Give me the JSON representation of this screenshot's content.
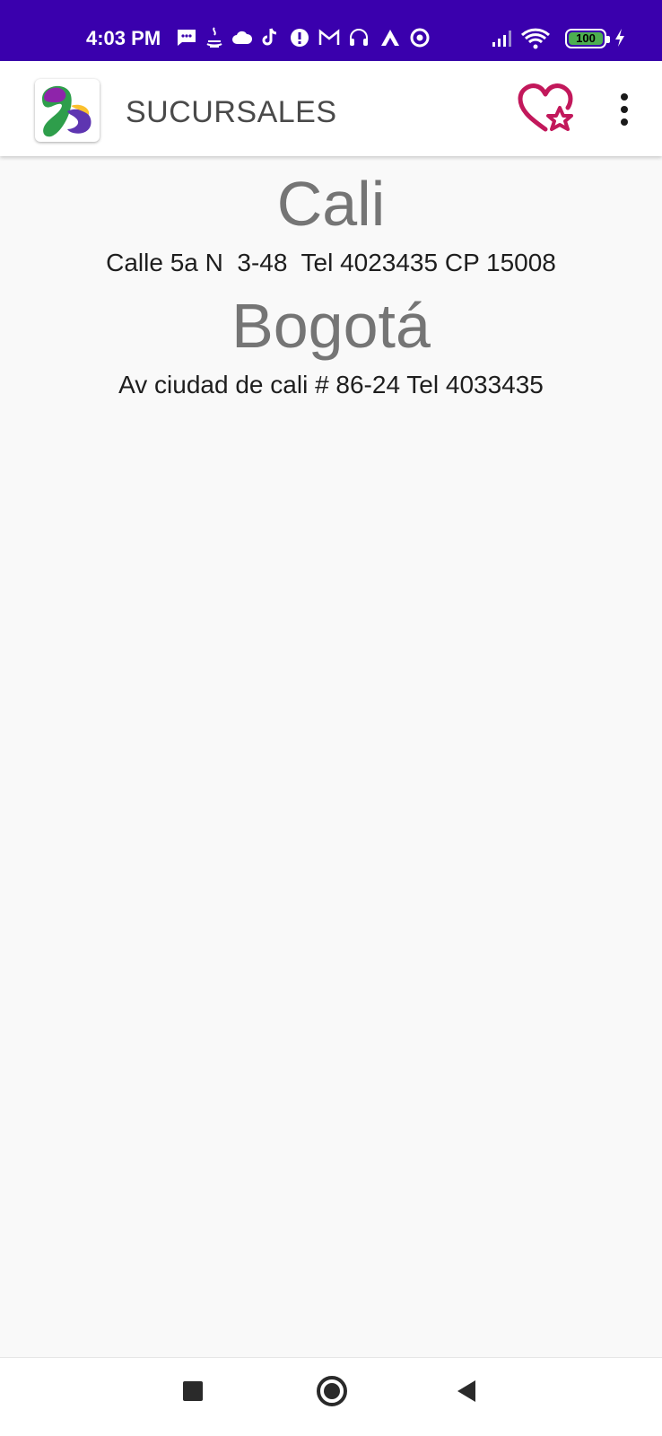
{
  "status_bar": {
    "time": "4:03 PM",
    "battery_level": "100",
    "notification_icons": [
      "message-icon",
      "java-icon",
      "cloud-icon",
      "tiktok-icon",
      "alert-icon",
      "gmail-icon",
      "headset-icon",
      "arc-icon",
      "at-icon"
    ],
    "system_icons": [
      "signal-icon",
      "wifi-icon",
      "battery-icon",
      "charging-icon"
    ]
  },
  "app_bar": {
    "title": "SUCURSALES",
    "logo_icon": "app-logo",
    "favorite_icon": "heart-star-icon",
    "menu_icon": "more-vert-icon",
    "accent_color": "#c2185b"
  },
  "branches": [
    {
      "city": "Cali",
      "address": "Calle 5a N  3-48  Tel 4023435 CP 15008"
    },
    {
      "city": "Bogotá",
      "address": "Av ciudad de cali # 86-24 Tel 4033435"
    }
  ],
  "nav_bar": {
    "recents_icon": "square-icon",
    "home_icon": "circle-icon",
    "back_icon": "triangle-back-icon"
  },
  "colors": {
    "status_bar": "#3a00ad",
    "background": "#f9f9f9",
    "city_text": "#757575",
    "address_text": "#1e1e1e"
  }
}
